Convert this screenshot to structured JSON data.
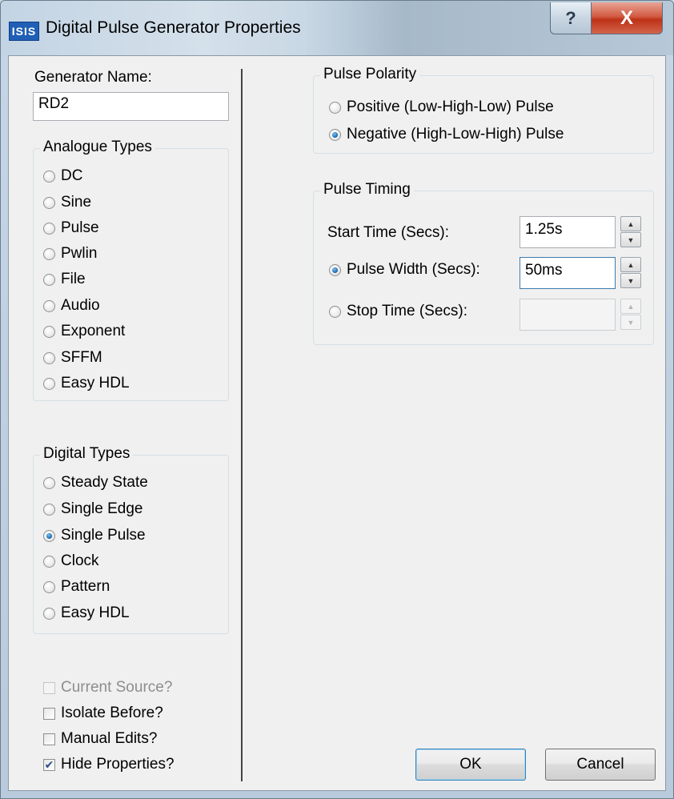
{
  "window": {
    "app_icon_text": "ISIS",
    "title": "Digital Pulse Generator Properties",
    "help_glyph": "?",
    "close_glyph": "X"
  },
  "generator": {
    "label": "Generator Name:",
    "value": "RD2"
  },
  "analogue": {
    "title": "Analogue Types",
    "items": [
      "DC",
      "Sine",
      "Pulse",
      "Pwlin",
      "File",
      "Audio",
      "Exponent",
      "SFFM",
      "Easy HDL"
    ]
  },
  "digital": {
    "title": "Digital Types",
    "items": [
      "Steady State",
      "Single Edge",
      "Single Pulse",
      "Clock",
      "Pattern",
      "Easy HDL"
    ],
    "selected": "Single Pulse"
  },
  "options": {
    "current_source": {
      "label": "Current Source?",
      "checked": false,
      "enabled": false
    },
    "isolate_before": {
      "label": "Isolate Before?",
      "checked": false,
      "enabled": true
    },
    "manual_edits": {
      "label": "Manual Edits?",
      "checked": false,
      "enabled": true
    },
    "hide_properties": {
      "label": "Hide Properties?",
      "checked": true,
      "enabled": true
    }
  },
  "polarity": {
    "title": "Pulse Polarity",
    "positive": "Positive (Low-High-Low) Pulse",
    "negative": "Negative (High-Low-High) Pulse",
    "selected": "negative"
  },
  "timing": {
    "title": "Pulse Timing",
    "start_label": "Start Time (Secs):",
    "start_value": "1.25s",
    "width_label": "Pulse Width (Secs):",
    "width_value": "50ms",
    "stop_label": "Stop Time (Secs):",
    "stop_value": "",
    "selected": "width"
  },
  "buttons": {
    "ok": "OK",
    "cancel": "Cancel"
  },
  "colors": {
    "accent": "#1f6fb5",
    "close": "#c8402a"
  }
}
